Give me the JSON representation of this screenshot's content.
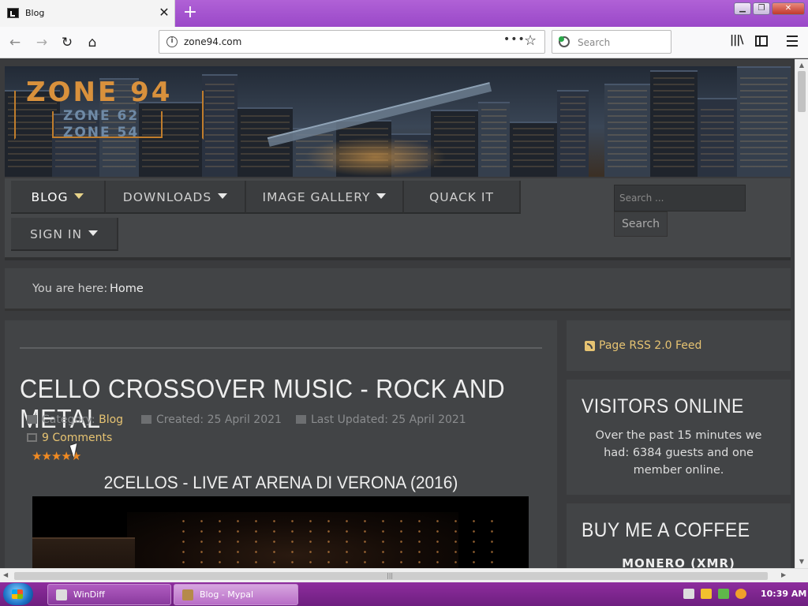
{
  "browser": {
    "tab_title": "Blog",
    "url": "zone94.com",
    "search_placeholder": "Search"
  },
  "logo": {
    "main": "ZONE 94",
    "sub1": "ZONE 62",
    "sub2": "ZONE 54"
  },
  "menu": {
    "items": [
      {
        "label": "BLOG",
        "dropdown": true
      },
      {
        "label": "DOWNLOADS",
        "dropdown": true
      },
      {
        "label": "IMAGE GALLERY",
        "dropdown": true
      },
      {
        "label": "QUACK IT",
        "dropdown": false
      },
      {
        "label": "SIGN IN",
        "dropdown": true
      }
    ],
    "search_placeholder": "Search ...",
    "search_button": "Search"
  },
  "breadcrumb": {
    "label": "You are here:",
    "home": "Home"
  },
  "article": {
    "title": "CELLO CROSSOVER MUSIC - ROCK AND METAL",
    "category_label": "Category:",
    "category": "Blog",
    "created": "Created: 25 April 2021",
    "updated": "Last Updated: 25 April 2021",
    "comments": "9 Comments",
    "rating_stars": 5,
    "video_title": "2CELLOS - LIVE AT ARENA DI VERONA (2016)"
  },
  "sidebar": {
    "rss": "Page RSS 2.0 Feed",
    "visitors_title": "VISITORS ONLINE",
    "visitors_text": "Over the past 15 minutes we had: 6384 guests and one member online.",
    "coffee_title": "BUY ME A COFFEE",
    "coffee_sub": "MONERO (XMR)"
  },
  "taskbar": {
    "items": [
      {
        "label": "WinDiff",
        "active": false
      },
      {
        "label": "Blog - Mypal",
        "active": true
      }
    ],
    "clock": "10:39 AM"
  },
  "colors": {
    "accent": "#e6c372",
    "titlebar": "#9a48c8",
    "page_bg": "#3a3b3d",
    "panel_bg": "#424446",
    "star": "#f08a22"
  }
}
